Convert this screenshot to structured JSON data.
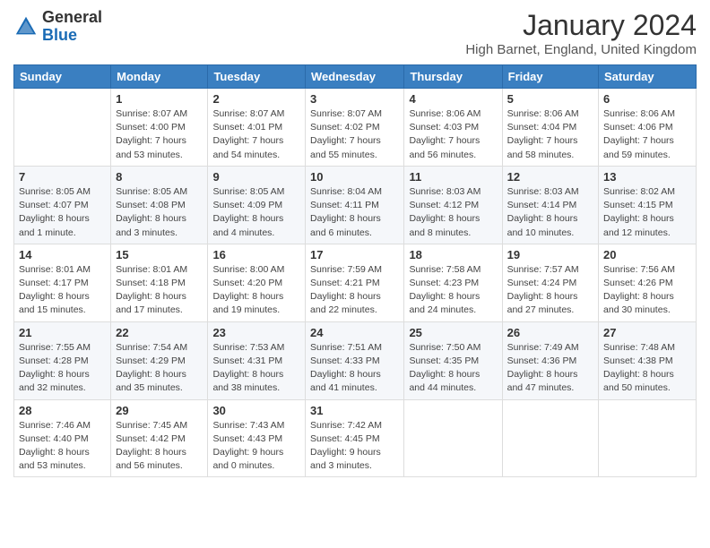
{
  "header": {
    "logo_general": "General",
    "logo_blue": "Blue",
    "month_title": "January 2024",
    "location": "High Barnet, England, United Kingdom"
  },
  "calendar": {
    "days_of_week": [
      "Sunday",
      "Monday",
      "Tuesday",
      "Wednesday",
      "Thursday",
      "Friday",
      "Saturday"
    ],
    "weeks": [
      [
        {
          "day": "",
          "info": ""
        },
        {
          "day": "1",
          "info": "Sunrise: 8:07 AM\nSunset: 4:00 PM\nDaylight: 7 hours\nand 53 minutes."
        },
        {
          "day": "2",
          "info": "Sunrise: 8:07 AM\nSunset: 4:01 PM\nDaylight: 7 hours\nand 54 minutes."
        },
        {
          "day": "3",
          "info": "Sunrise: 8:07 AM\nSunset: 4:02 PM\nDaylight: 7 hours\nand 55 minutes."
        },
        {
          "day": "4",
          "info": "Sunrise: 8:06 AM\nSunset: 4:03 PM\nDaylight: 7 hours\nand 56 minutes."
        },
        {
          "day": "5",
          "info": "Sunrise: 8:06 AM\nSunset: 4:04 PM\nDaylight: 7 hours\nand 58 minutes."
        },
        {
          "day": "6",
          "info": "Sunrise: 8:06 AM\nSunset: 4:06 PM\nDaylight: 7 hours\nand 59 minutes."
        }
      ],
      [
        {
          "day": "7",
          "info": "Sunrise: 8:05 AM\nSunset: 4:07 PM\nDaylight: 8 hours\nand 1 minute."
        },
        {
          "day": "8",
          "info": "Sunrise: 8:05 AM\nSunset: 4:08 PM\nDaylight: 8 hours\nand 3 minutes."
        },
        {
          "day": "9",
          "info": "Sunrise: 8:05 AM\nSunset: 4:09 PM\nDaylight: 8 hours\nand 4 minutes."
        },
        {
          "day": "10",
          "info": "Sunrise: 8:04 AM\nSunset: 4:11 PM\nDaylight: 8 hours\nand 6 minutes."
        },
        {
          "day": "11",
          "info": "Sunrise: 8:03 AM\nSunset: 4:12 PM\nDaylight: 8 hours\nand 8 minutes."
        },
        {
          "day": "12",
          "info": "Sunrise: 8:03 AM\nSunset: 4:14 PM\nDaylight: 8 hours\nand 10 minutes."
        },
        {
          "day": "13",
          "info": "Sunrise: 8:02 AM\nSunset: 4:15 PM\nDaylight: 8 hours\nand 12 minutes."
        }
      ],
      [
        {
          "day": "14",
          "info": "Sunrise: 8:01 AM\nSunset: 4:17 PM\nDaylight: 8 hours\nand 15 minutes."
        },
        {
          "day": "15",
          "info": "Sunrise: 8:01 AM\nSunset: 4:18 PM\nDaylight: 8 hours\nand 17 minutes."
        },
        {
          "day": "16",
          "info": "Sunrise: 8:00 AM\nSunset: 4:20 PM\nDaylight: 8 hours\nand 19 minutes."
        },
        {
          "day": "17",
          "info": "Sunrise: 7:59 AM\nSunset: 4:21 PM\nDaylight: 8 hours\nand 22 minutes."
        },
        {
          "day": "18",
          "info": "Sunrise: 7:58 AM\nSunset: 4:23 PM\nDaylight: 8 hours\nand 24 minutes."
        },
        {
          "day": "19",
          "info": "Sunrise: 7:57 AM\nSunset: 4:24 PM\nDaylight: 8 hours\nand 27 minutes."
        },
        {
          "day": "20",
          "info": "Sunrise: 7:56 AM\nSunset: 4:26 PM\nDaylight: 8 hours\nand 30 minutes."
        }
      ],
      [
        {
          "day": "21",
          "info": "Sunrise: 7:55 AM\nSunset: 4:28 PM\nDaylight: 8 hours\nand 32 minutes."
        },
        {
          "day": "22",
          "info": "Sunrise: 7:54 AM\nSunset: 4:29 PM\nDaylight: 8 hours\nand 35 minutes."
        },
        {
          "day": "23",
          "info": "Sunrise: 7:53 AM\nSunset: 4:31 PM\nDaylight: 8 hours\nand 38 minutes."
        },
        {
          "day": "24",
          "info": "Sunrise: 7:51 AM\nSunset: 4:33 PM\nDaylight: 8 hours\nand 41 minutes."
        },
        {
          "day": "25",
          "info": "Sunrise: 7:50 AM\nSunset: 4:35 PM\nDaylight: 8 hours\nand 44 minutes."
        },
        {
          "day": "26",
          "info": "Sunrise: 7:49 AM\nSunset: 4:36 PM\nDaylight: 8 hours\nand 47 minutes."
        },
        {
          "day": "27",
          "info": "Sunrise: 7:48 AM\nSunset: 4:38 PM\nDaylight: 8 hours\nand 50 minutes."
        }
      ],
      [
        {
          "day": "28",
          "info": "Sunrise: 7:46 AM\nSunset: 4:40 PM\nDaylight: 8 hours\nand 53 minutes."
        },
        {
          "day": "29",
          "info": "Sunrise: 7:45 AM\nSunset: 4:42 PM\nDaylight: 8 hours\nand 56 minutes."
        },
        {
          "day": "30",
          "info": "Sunrise: 7:43 AM\nSunset: 4:43 PM\nDaylight: 9 hours\nand 0 minutes."
        },
        {
          "day": "31",
          "info": "Sunrise: 7:42 AM\nSunset: 4:45 PM\nDaylight: 9 hours\nand 3 minutes."
        },
        {
          "day": "",
          "info": ""
        },
        {
          "day": "",
          "info": ""
        },
        {
          "day": "",
          "info": ""
        }
      ]
    ]
  }
}
